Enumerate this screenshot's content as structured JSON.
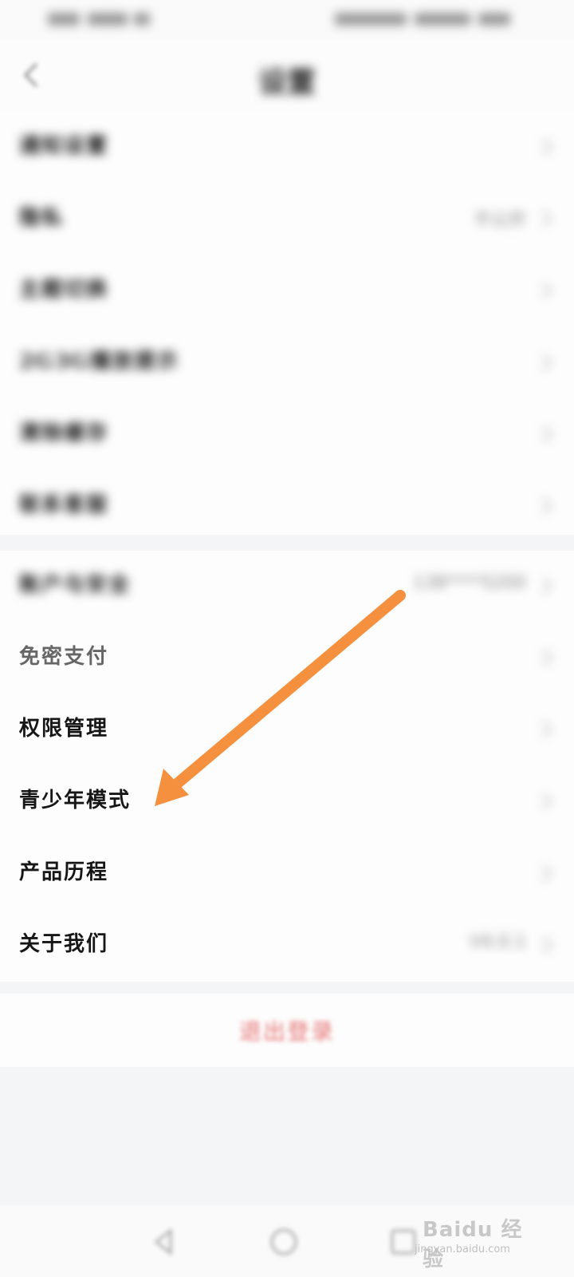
{
  "header": {
    "title": "设置"
  },
  "section_top": {
    "items": [
      {
        "label": "通知设置",
        "value": ""
      },
      {
        "label": "隐私",
        "value": "不公开"
      },
      {
        "label": "主题切换",
        "value": ""
      },
      {
        "label": "2G3G播放提示",
        "value": ""
      },
      {
        "label": "清除缓存",
        "value": ""
      },
      {
        "label": "联系客服",
        "value": ""
      }
    ]
  },
  "section_bottom": {
    "items": [
      {
        "label": "账户与安全",
        "value": "138****5200"
      },
      {
        "label": "免密支付",
        "value": ""
      },
      {
        "label": "权限管理",
        "value": ""
      },
      {
        "label": "青少年模式",
        "value": ""
      },
      {
        "label": "产品历程",
        "value": ""
      },
      {
        "label": "关于我们",
        "value": "V4.0.1"
      }
    ]
  },
  "logout": {
    "label": "退出登录"
  },
  "annotation": {
    "arrow_color": "#f5913e"
  },
  "watermark": {
    "main": "Baidu 经验",
    "sub": "jingyan.baidu.com"
  }
}
